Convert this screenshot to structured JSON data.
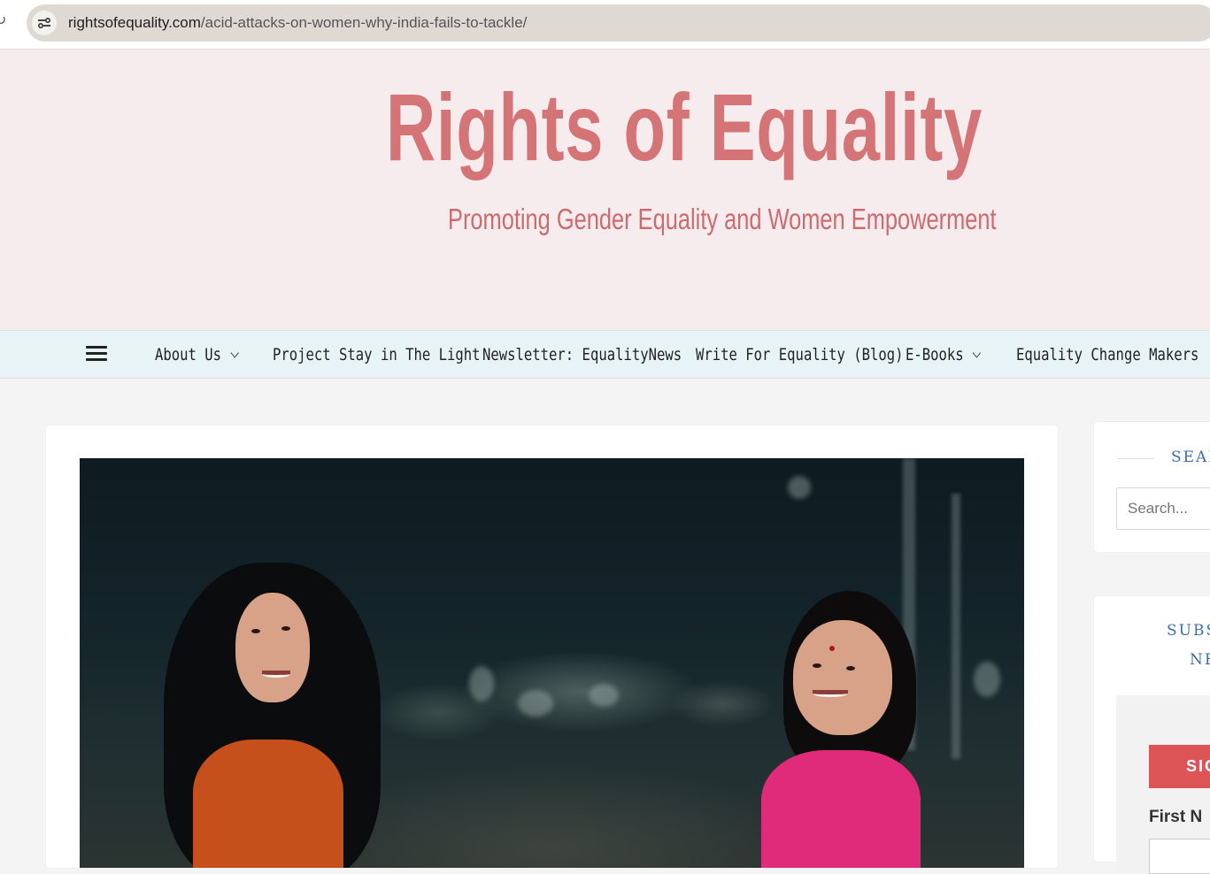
{
  "browser": {
    "url_domain": "rightsofequality.com",
    "url_path": "/acid-attacks-on-women-why-india-fails-to-tackle/"
  },
  "header": {
    "site_title": "Rights of Equality",
    "tagline": "Promoting Gender Equality and Women Empowerment",
    "title_color": "#d47476",
    "background_color": "#f6ecee"
  },
  "nav": {
    "items": [
      {
        "label": "About Us",
        "has_dropdown": true
      },
      {
        "label": "Project Stay in The Light",
        "has_dropdown": false
      },
      {
        "label": "Newsletter: EqualityNews",
        "has_dropdown": false
      },
      {
        "label": "Write For Equality (Blog)",
        "has_dropdown": false
      },
      {
        "label": "E-Books",
        "has_dropdown": true
      },
      {
        "label": "Equality Change Makers",
        "has_dropdown": false
      }
    ],
    "menu_icon": "hamburger-icon"
  },
  "sidebar": {
    "search": {
      "title": "SEAI",
      "placeholder": "Search..."
    },
    "subscribe": {
      "title_line1": "SUBS",
      "title_line2": "NE",
      "signup_label": "SIG",
      "first_name_label": "First N"
    },
    "accent_color": "#dd5456",
    "title_color": "#3b6fa5"
  }
}
